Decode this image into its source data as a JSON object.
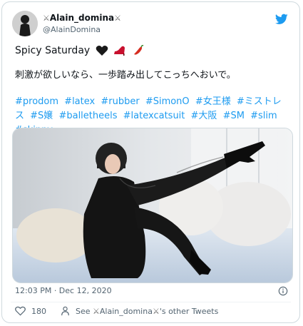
{
  "tweet": {
    "display_name": "Alain_domina",
    "handle": "@AlainDomina",
    "text_line1": "Spicy Saturday",
    "text_line2": "刺激が欲しいなら、一歩踏み出してこっちへおいで。",
    "hashtags": [
      "#prodom",
      "#latex",
      "#rubber",
      "#SimonO",
      "#女王様",
      "#ミストレス",
      "#S嬢",
      "#balletheels",
      "#latexcatsuit",
      "#大阪",
      "#SM",
      "#slim",
      "#skinny"
    ],
    "timestamp": "12:03 PM · Dec 12, 2020",
    "like_count": "180",
    "other_tweets_prefix": "See",
    "other_tweets_name": "Alain_domina",
    "other_tweets_suffix": "'s other Tweets"
  },
  "colors": {
    "link": "#1d9bf0",
    "muted": "#536471",
    "border": "#cfd9de"
  },
  "icons": [
    "twitter-bird-icon",
    "info-icon",
    "heart-icon",
    "person-icon",
    "crossed-swords-icon"
  ]
}
